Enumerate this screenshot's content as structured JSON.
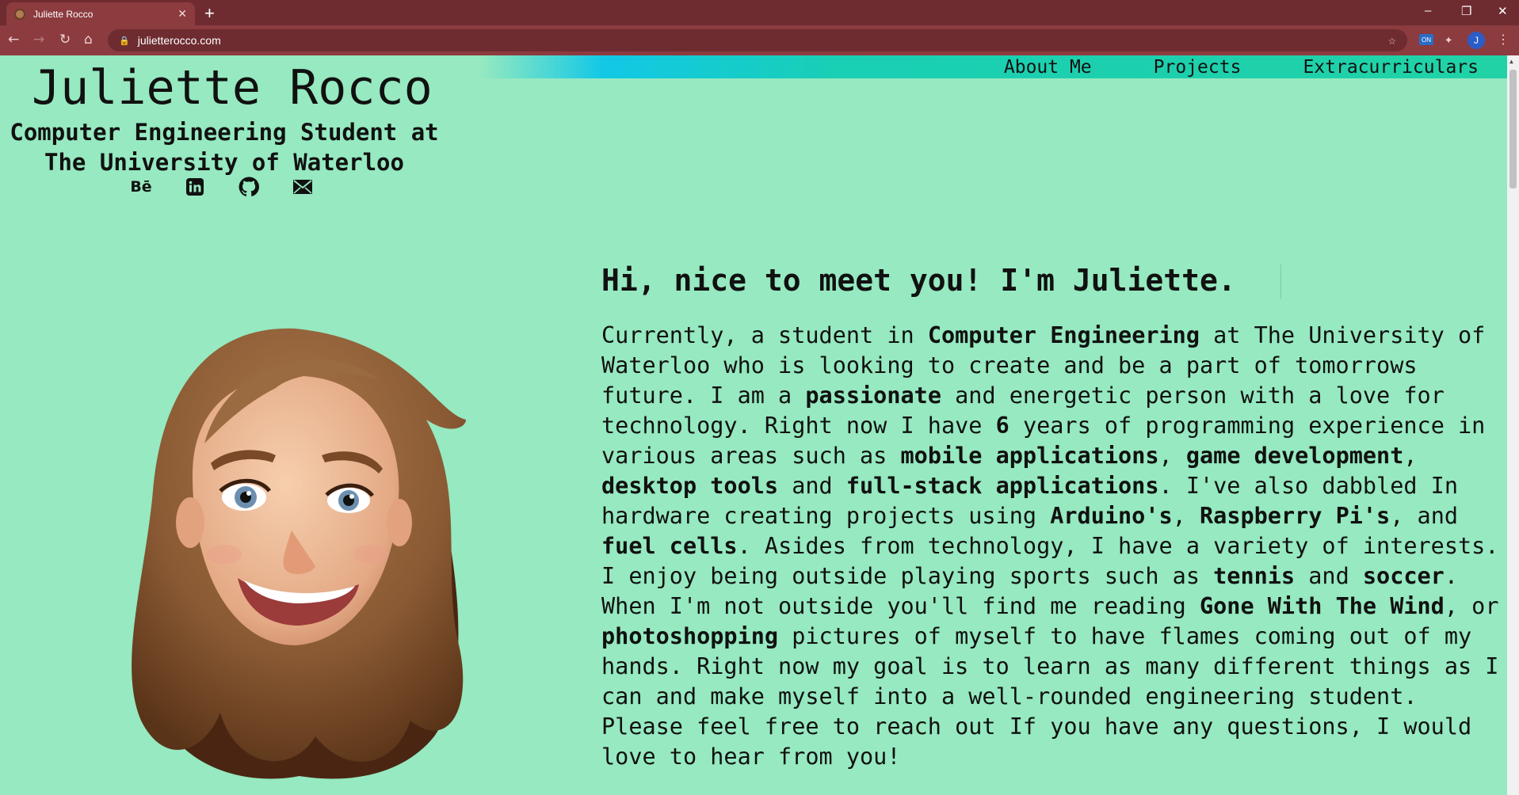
{
  "browser": {
    "tab_title": "Juliette Rocco",
    "tab_close": "✕",
    "new_tab": "+",
    "url": "julietterocco.com",
    "profile_initial": "J",
    "extension_label": "ON",
    "window_controls": [
      "–",
      "❐",
      "✕"
    ]
  },
  "nav": {
    "about": "About Me",
    "projects": "Projects",
    "extracurriculars": "Extracurriculars"
  },
  "header": {
    "name": "Juliette Rocco",
    "subtitle_line1": "Computer Engineering Student at",
    "subtitle_line2": "The University of Waterloo",
    "behance_label": "Bē",
    "social_icons": [
      "behance-icon",
      "linkedin-icon",
      "github-icon",
      "email-icon"
    ]
  },
  "intro": {
    "greeting": "Hi, nice to meet you! I'm Juliette.",
    "bio": [
      {
        "t": "Currently, a student in "
      },
      {
        "t": "Computer Engineering",
        "b": true
      },
      {
        "t": " at The University of Waterloo who is looking to create and be a part of tomorrows future. I am a "
      },
      {
        "t": "passionate",
        "b": true
      },
      {
        "t": " and energetic person with a love for technology. Right now I have "
      },
      {
        "t": "6",
        "b": true
      },
      {
        "t": " years of programming experience in various areas such as "
      },
      {
        "t": "mobile applications",
        "b": true
      },
      {
        "t": ", "
      },
      {
        "t": "game development",
        "b": true
      },
      {
        "t": ", "
      },
      {
        "t": "desktop tools",
        "b": true
      },
      {
        "t": " and "
      },
      {
        "t": "full-stack applications",
        "b": true
      },
      {
        "t": ". I've also dabbled In hardware creating projects using "
      },
      {
        "t": "Arduino's",
        "b": true
      },
      {
        "t": ", "
      },
      {
        "t": "Raspberry Pi's",
        "b": true
      },
      {
        "t": ", and "
      },
      {
        "t": "fuel cells",
        "b": true
      },
      {
        "t": ". Asides from technology, I have a variety of interests. I enjoy being outside playing sports such as "
      },
      {
        "t": "tennis",
        "b": true
      },
      {
        "t": " and "
      },
      {
        "t": "soccer",
        "b": true
      },
      {
        "t": ". When I'm not outside you'll find me reading "
      },
      {
        "t": "Gone With The Wind",
        "b": true
      },
      {
        "t": ", or "
      },
      {
        "t": "photoshopping",
        "b": true
      },
      {
        "t": " pictures of myself to have flames coming out of my hands. Right now my goal is to learn as many different things as I can and make myself into a well-rounded engineering student. Please feel free to reach out If you have any questions, I would love to hear from you!"
      }
    ]
  },
  "colors": {
    "page_bg": "#96e9c0",
    "nav_gradient_start": "#12c8e6",
    "nav_gradient_end": "#21d2a6",
    "browser_frame": "#6e2c31",
    "browser_toolbar": "#8c3b3f"
  }
}
